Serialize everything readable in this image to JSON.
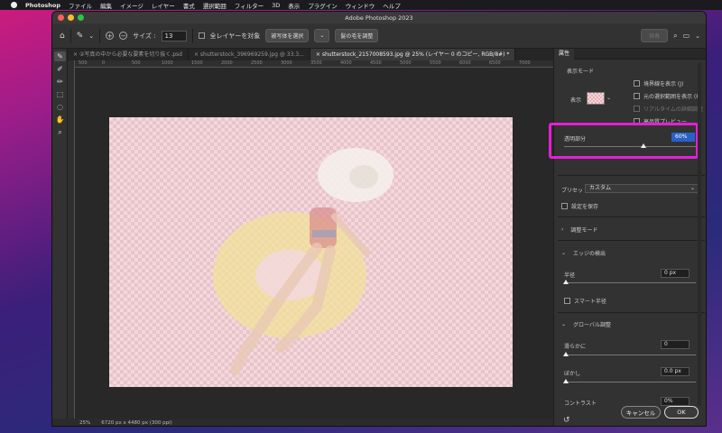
{
  "menubar": {
    "app": "Photoshop",
    "items": [
      "ファイル",
      "編集",
      "イメージ",
      "レイヤー",
      "書式",
      "選択範囲",
      "フィルター",
      "3D",
      "表示",
      "プラグイン",
      "ウィンドウ",
      "ヘルプ"
    ]
  },
  "window": {
    "title": "Adobe Photoshop 2023"
  },
  "options": {
    "size_label": "サイズ :",
    "size_value": "13",
    "all_layers": "全レイヤーを対象",
    "select_subject": "被写体を選択",
    "refine_hair": "髪の毛を調整",
    "search_placeholder": "共有"
  },
  "tabs": [
    "②写真の中から必要な要素を切り抜く.psd",
    "shutterstock_396969259.jpg @ 33.3...",
    "shutterstock_2157008593.jpg @ 25% (レイヤー 0 のコピー, RGB/8#) *"
  ],
  "ruler": [
    "500",
    "0",
    "500",
    "1000",
    "1500",
    "2000",
    "2500",
    "3000",
    "3500",
    "4000",
    "4500",
    "5000",
    "5500",
    "6000",
    "6500",
    "7000"
  ],
  "status": {
    "zoom": "25%",
    "dimensions": "6720 px x 4480 px (300 ppi)"
  },
  "panel": {
    "tab": "属性",
    "view_mode": "表示モード",
    "view_label": "表示",
    "show_edges": "境界線を表示 (J)",
    "show_original": "元の選択範囲を表示 (P)",
    "realtime": "リアルタイムの詳細調整",
    "hq_preview": "高品質プレビュー",
    "transparency_label": "透明部分",
    "transparency_value": "60%",
    "preset_label": "プリセット",
    "preset_value": "カスタム",
    "save_settings": "設定を保存",
    "adjust_mode": "調整モード",
    "edge_detection": "エッジの検出",
    "radius_label": "半径",
    "radius_value": "0 px",
    "smart_radius": "スマート半径",
    "global_refine": "グローバル調整",
    "smooth_label": "滑らかに",
    "smooth_value": "0",
    "feather_label": "ぼかし",
    "feather_value": "0.0 px",
    "contrast_label": "コントラスト",
    "contrast_value": "0%",
    "cancel": "キャンセル",
    "ok": "OK",
    "transparency_level": 0.6
  }
}
